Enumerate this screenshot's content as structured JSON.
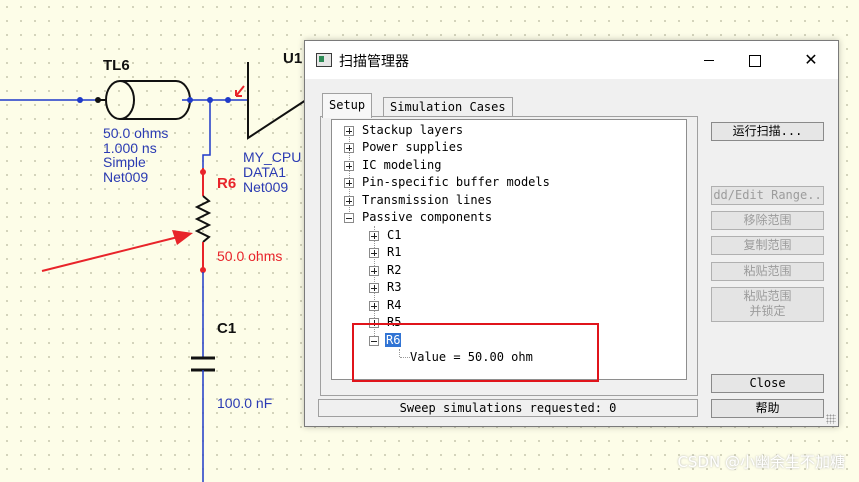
{
  "schematic": {
    "tline": {
      "ref": "TL6",
      "impedance": "50.0 ohms",
      "delay": "1.000 ns",
      "model": "Simple",
      "net": "Net009"
    },
    "driver": {
      "ref": "U1",
      "part": "MY_CPU",
      "pin": "DATA1",
      "net": "Net009"
    },
    "resistor": {
      "ref": "R6",
      "value": "50.0 ohms"
    },
    "capacitor": {
      "ref": "C1",
      "value": "100.0 nF"
    },
    "colors": {
      "wire": "#1f3ac9",
      "highlight": "#e8242a",
      "component": "#111111"
    }
  },
  "dialog": {
    "title": "扫描管理器",
    "tabs": [
      "Setup",
      "Simulation Cases"
    ],
    "active_tab": "Setup",
    "tree": {
      "root_items": [
        "Stackup layers",
        "Power supplies",
        "IC modeling",
        "Pin-specific buffer models",
        "Transmission lines"
      ],
      "expanded_item": "Passive components",
      "children": [
        "C1",
        "R1",
        "R2",
        "R3",
        "R4",
        "R5"
      ],
      "selected_child": "R6",
      "selected_value": "Value = 50.00 ohm"
    },
    "buttons": {
      "run": "运行扫描...",
      "add_edit": "dd/Edit Range..",
      "remove": "移除范围",
      "copy": "复制范围",
      "paste": "粘贴范围",
      "paste_lock": "粘贴范围",
      "paste_lock_2": "并锁定",
      "close": "Close",
      "help": "帮助"
    },
    "status": "Sweep simulations requested: 0"
  },
  "watermark": "CSDN @小幽余生不加糖"
}
